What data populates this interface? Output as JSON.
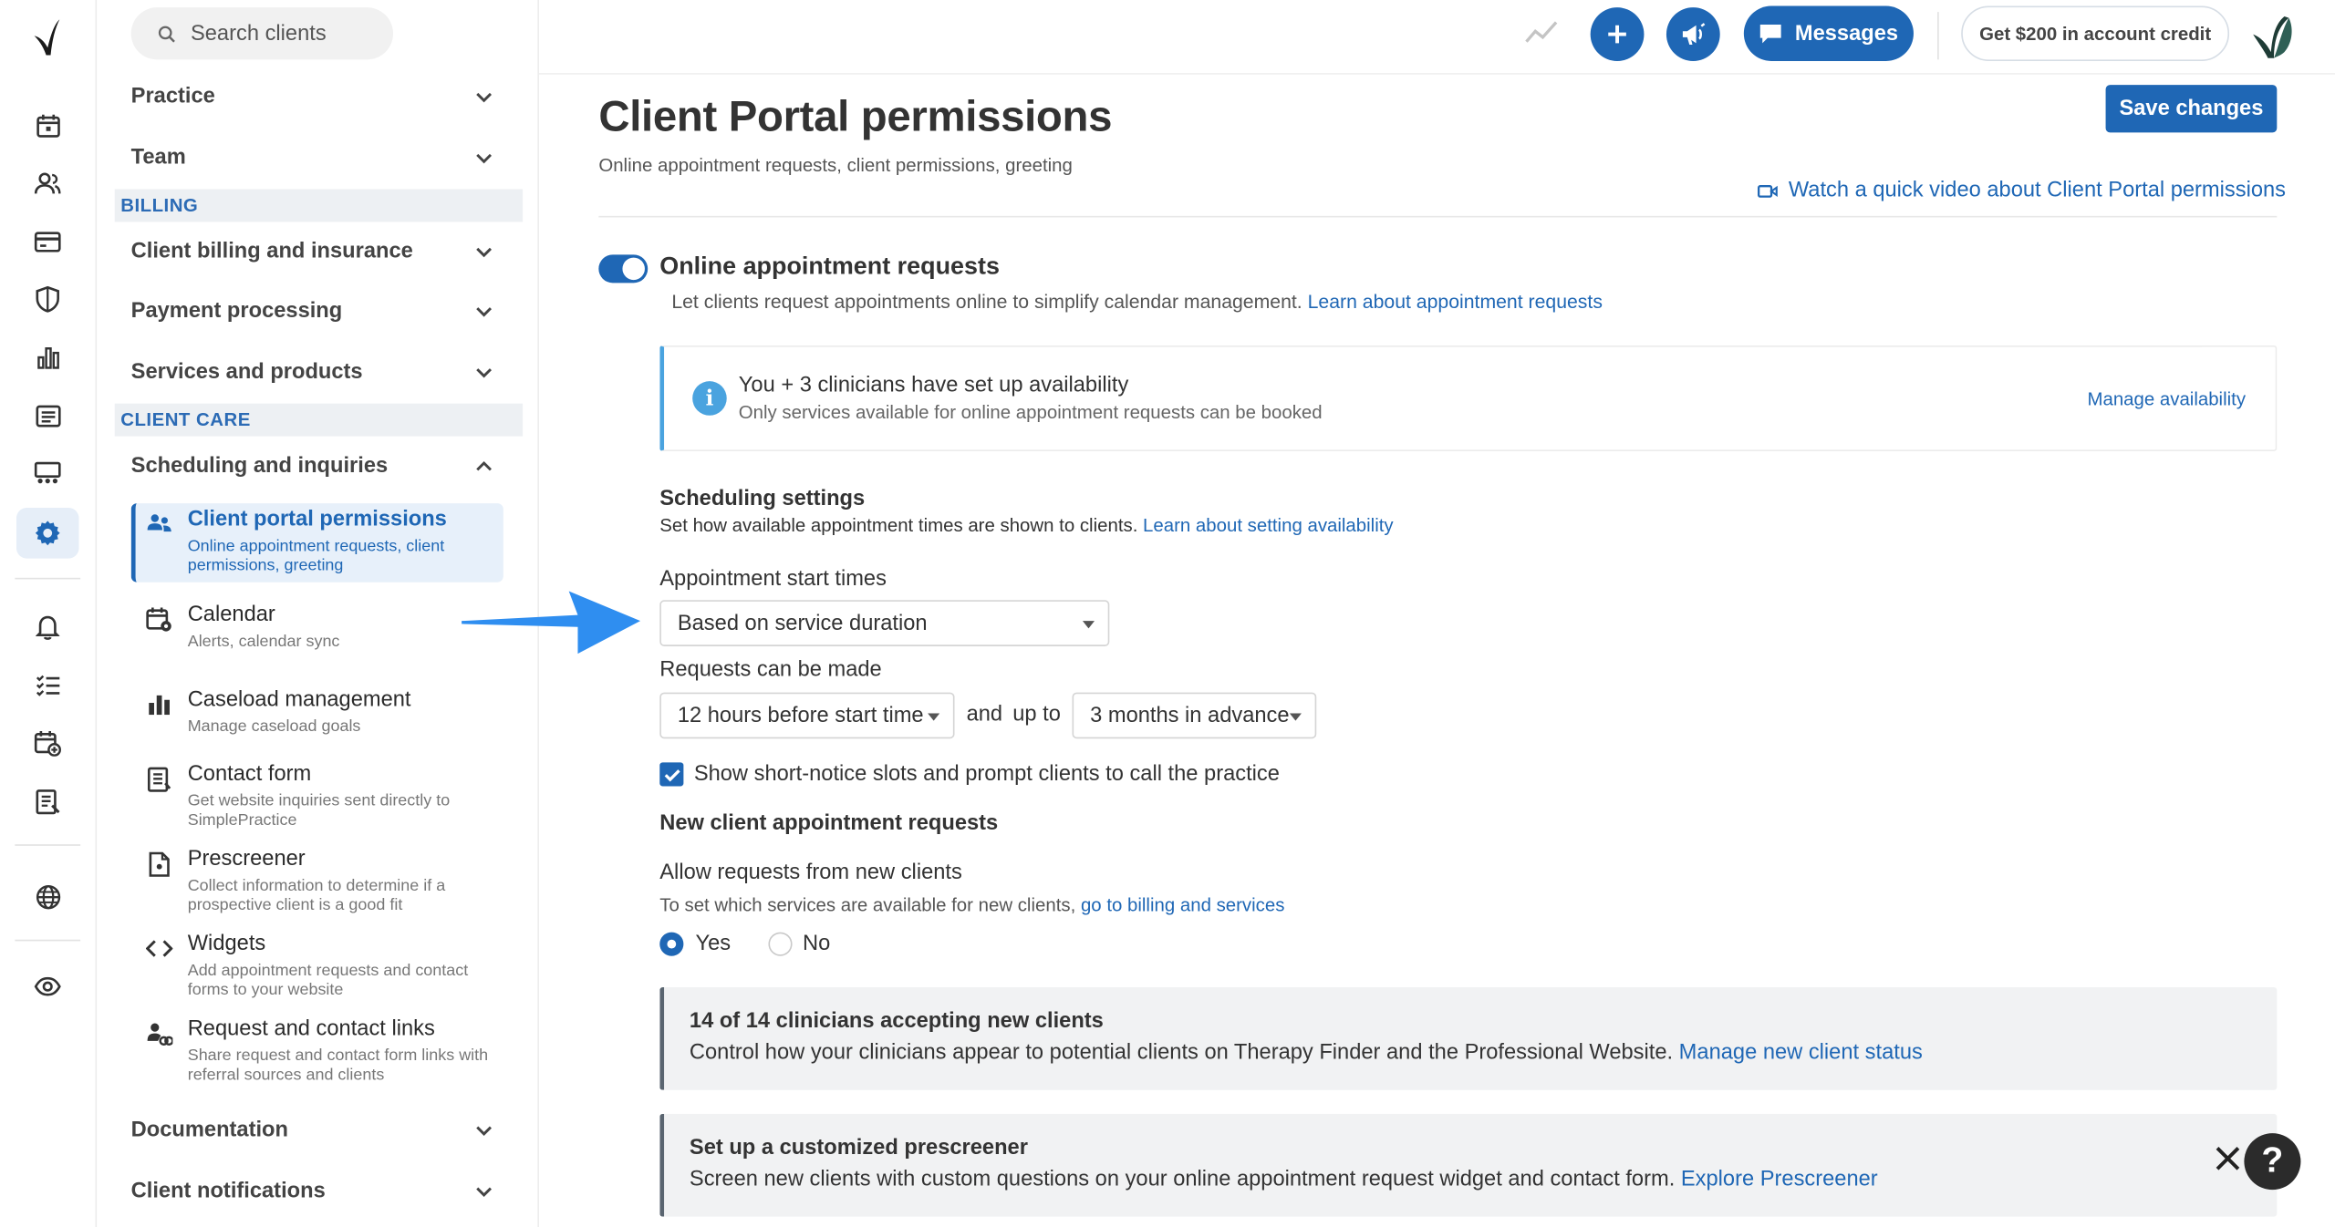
{
  "search": {
    "placeholder": "Search clients"
  },
  "topbar": {
    "messages_label": "Messages",
    "credit_label": "Get $200 in account credit"
  },
  "sidebar": {
    "groups": {
      "practice": "Practice",
      "team": "Team",
      "client_billing": "Client billing and insurance",
      "payment_processing": "Payment processing",
      "services_products": "Services and products",
      "scheduling": "Scheduling and inquiries",
      "documentation": "Documentation",
      "client_notifications": "Client notifications"
    },
    "sections": {
      "billing": "BILLING",
      "client_care": "CLIENT CARE"
    },
    "items": [
      {
        "label": "Client portal permissions",
        "desc": "Online appointment requests, client permissions, greeting",
        "icon": "users-icon"
      },
      {
        "label": "Calendar",
        "desc": "Alerts, calendar sync",
        "icon": "calendar-gear-icon"
      },
      {
        "label": "Caseload management",
        "desc": "Manage caseload goals",
        "icon": "bar-chart-icon"
      },
      {
        "label": "Contact form",
        "desc": "Get website inquiries sent directly to SimplePractice",
        "icon": "form-icon"
      },
      {
        "label": "Prescreener",
        "desc": "Collect information to determine if a prospective client is a good fit",
        "icon": "document-icon"
      },
      {
        "label": "Widgets",
        "desc": "Add appointment requests and contact forms to your website",
        "icon": "code-icon"
      },
      {
        "label": "Request and contact links",
        "desc": "Share request and contact form links with referral sources and clients",
        "icon": "link-user-icon"
      }
    ]
  },
  "main": {
    "title": "Client Portal permissions",
    "subtitle": "Online appointment requests, client permissions, greeting",
    "save_label": "Save changes",
    "video_link": "Watch a quick video about Client Portal permissions",
    "online_requests": {
      "title": "Online appointment requests",
      "desc": "Let clients request appointments online to simplify calendar management.",
      "desc_link": "Learn about appointment requests",
      "enabled": true
    },
    "availability_box": {
      "title": "You + 3 clinicians have set up availability",
      "desc": "Only services available for online appointment requests can be booked",
      "link": "Manage availability"
    },
    "scheduling": {
      "title": "Scheduling settings",
      "desc": "Set how available appointment times are shown to clients.",
      "desc_link": "Learn about setting availability",
      "start_times_label": "Appointment start times",
      "start_times_value": "Based on service duration",
      "requests_label": "Requests can be made",
      "min_notice_value": "12 hours before start time",
      "and_text": "and",
      "up_to_text": "up to",
      "max_advance_value": "3 months in advance",
      "short_notice_label": "Show short-notice slots and prompt clients to call the practice",
      "short_notice_checked": true
    },
    "new_clients": {
      "title": "New client appointment requests",
      "allow_label": "Allow requests from new clients",
      "services_text": "To set which services are available for new clients,",
      "services_link": "go to billing and services",
      "yes_label": "Yes",
      "no_label": "No",
      "selected": "Yes"
    },
    "clinicians_box": {
      "title": "14 of 14 clinicians accepting new clients",
      "desc": "Control how your clinicians appear to potential clients on Therapy Finder and the Professional Website.",
      "link": "Manage new client status"
    },
    "prescreener_box": {
      "title": "Set up a customized prescreener",
      "desc": "Screen new clients with custom questions on your online appointment request widget and contact form.",
      "link": "Explore Prescreener"
    }
  },
  "help": {
    "label": "?"
  },
  "colors": {
    "accent": "#1f67b5",
    "info": "#4aa3df",
    "annotation_arrow": "#2f8ef0"
  }
}
